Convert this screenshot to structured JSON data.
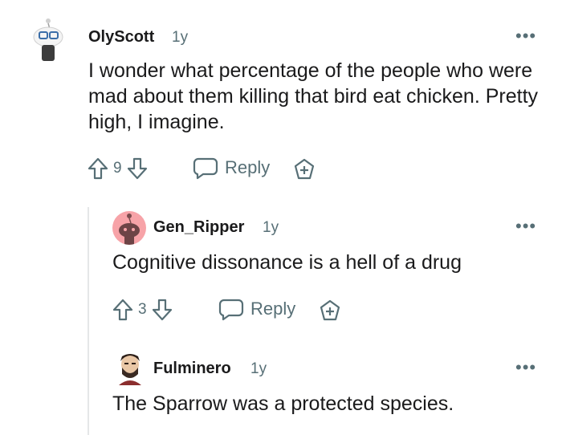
{
  "comments": [
    {
      "username": "OlyScott",
      "age": "1y",
      "text": "I wonder what percentage of the people who were mad about them killing that bird eat chicken. Pretty high, I imagine.",
      "score": "9",
      "reply_label": "Reply",
      "more_label": "•••"
    },
    {
      "username": "Gen_Ripper",
      "age": "1y",
      "text": "Cognitive dissonance is a hell of a drug",
      "score": "3",
      "reply_label": "Reply",
      "more_label": "•••"
    },
    {
      "username": "Fulminero",
      "age": "1y",
      "text": "The Sparrow was a protected species.",
      "more_label": "•••"
    }
  ],
  "colors": {
    "text": "#1a1a1b",
    "muted": "#576f76",
    "thread_line": "#e5e7e8",
    "avatar_pink": "#f7a3a8"
  }
}
